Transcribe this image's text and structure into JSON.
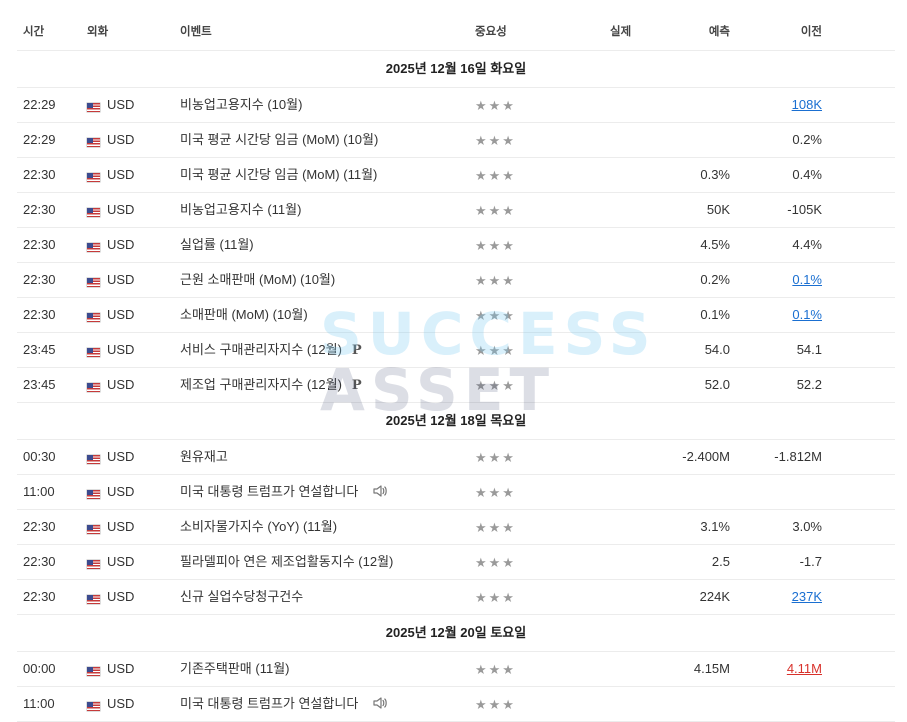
{
  "columns": {
    "time": "시간",
    "currency": "외화",
    "event": "이벤트",
    "importance": "중요성",
    "actual": "실제",
    "forecast": "예측",
    "previous": "이전"
  },
  "watermark": {
    "line1": "SUCCESS",
    "line2": "ASSET"
  },
  "colors": {
    "link": "#1a6fd1",
    "negative": "#d8312b",
    "star": "#9a9a9a"
  },
  "groups": [
    {
      "date": "2025년 12월 16일 화요일",
      "rows": [
        {
          "time": "22:29",
          "cur": "USD",
          "event": "비농업고용지수  (10월)",
          "stars": "★★★",
          "forecast": "",
          "previous": "108K",
          "prev_style": "link"
        },
        {
          "time": "22:29",
          "cur": "USD",
          "event": "미국 평균 시간당 임금 (MoM) (10월)",
          "stars": "★★★",
          "forecast": "",
          "previous": "0.2%"
        },
        {
          "time": "22:30",
          "cur": "USD",
          "event": "미국 평균 시간당 임금 (MoM) (11월)",
          "stars": "★★★",
          "forecast": "0.3%",
          "previous": "0.4%"
        },
        {
          "time": "22:30",
          "cur": "USD",
          "event": "비농업고용지수  (11월)",
          "stars": "★★★",
          "forecast": "50K",
          "previous": "-105K"
        },
        {
          "time": "22:30",
          "cur": "USD",
          "event": "실업률  (11월)",
          "stars": "★★★",
          "forecast": "4.5%",
          "previous": "4.4%"
        },
        {
          "time": "22:30",
          "cur": "USD",
          "event": "근원 소매판매 (MoM) (10월)",
          "stars": "★★★",
          "forecast": "0.2%",
          "previous": "0.1%",
          "prev_style": "link"
        },
        {
          "time": "22:30",
          "cur": "USD",
          "event": "소매판매 (MoM) (10월)",
          "stars": "★★★",
          "forecast": "0.1%",
          "previous": "0.1%",
          "prev_style": "link"
        },
        {
          "time": "23:45",
          "cur": "USD",
          "event": "서비스 구매관리자지수  (12월)",
          "badge": "P",
          "stars": "★★★",
          "forecast": "54.0",
          "previous": "54.1"
        },
        {
          "time": "23:45",
          "cur": "USD",
          "event": "제조업 구매관리자지수  (12월)",
          "badge": "P",
          "stars": "★★★",
          "forecast": "52.0",
          "previous": "52.2"
        }
      ]
    },
    {
      "date": "2025년 12월 18일 목요일",
      "rows": [
        {
          "time": "00:30",
          "cur": "USD",
          "event": "원유재고",
          "stars": "★★★",
          "forecast": "-2.400M",
          "previous": "-1.812M"
        },
        {
          "time": "11:00",
          "cur": "USD",
          "event": "미국 대통령 트럼프가 연설합니다",
          "speaker": true,
          "stars": "★★★",
          "forecast": "",
          "previous": ""
        },
        {
          "time": "22:30",
          "cur": "USD",
          "event": "소비자물가지수 (YoY) (11월)",
          "stars": "★★★",
          "forecast": "3.1%",
          "previous": "3.0%"
        },
        {
          "time": "22:30",
          "cur": "USD",
          "event": "필라델피아 연은 제조업활동지수  (12월)",
          "stars": "★★★",
          "forecast": "2.5",
          "previous": "-1.7"
        },
        {
          "time": "22:30",
          "cur": "USD",
          "event": "신규 실업수당청구건수",
          "stars": "★★★",
          "forecast": "224K",
          "previous": "237K",
          "prev_style": "link"
        }
      ]
    },
    {
      "date": "2025년 12월 20일 토요일",
      "rows": [
        {
          "time": "00:00",
          "cur": "USD",
          "event": "기존주택판매  (11월)",
          "stars": "★★★",
          "forecast": "4.15M",
          "previous": "4.11M",
          "prev_style": "red"
        },
        {
          "time": "11:00",
          "cur": "USD",
          "event": "미국 대통령 트럼프가 연설합니다",
          "speaker": true,
          "stars": "★★★",
          "forecast": "",
          "previous": ""
        }
      ]
    }
  ]
}
